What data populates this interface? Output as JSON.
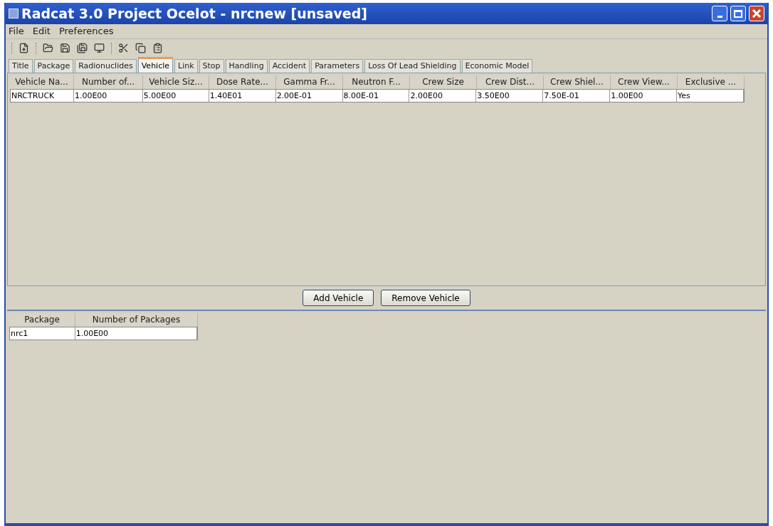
{
  "window": {
    "title": "Radcat 3.0 Project Ocelot - nrcnew [unsaved]"
  },
  "menu": [
    "File",
    "Edit",
    "Preferences"
  ],
  "tabs": [
    {
      "label": "Title",
      "selected": false
    },
    {
      "label": "Package",
      "selected": false
    },
    {
      "label": "Radionuclides",
      "selected": false
    },
    {
      "label": "Vehicle",
      "selected": true
    },
    {
      "label": "Link",
      "selected": false
    },
    {
      "label": "Stop",
      "selected": false
    },
    {
      "label": "Handling",
      "selected": false
    },
    {
      "label": "Accident",
      "selected": false
    },
    {
      "label": "Parameters",
      "selected": false
    },
    {
      "label": "Loss Of Lead Shielding",
      "selected": false
    },
    {
      "label": "Economic Model",
      "selected": false
    }
  ],
  "vehicle_table": {
    "columns": [
      "Vehicle Na...",
      "Number of...",
      "Vehicle Siz...",
      "Dose Rate...",
      "Gamma Fr...",
      "Neutron F...",
      "Crew Size",
      "Crew Dist...",
      "Crew Shiel...",
      "Crew View...",
      "Exclusive ..."
    ],
    "rows": [
      [
        "NRCTRUCK",
        "1.00E00",
        "5.00E00",
        "1.40E01",
        "2.00E-01",
        "8.00E-01",
        "2.00E00",
        "3.50E00",
        "7.50E-01",
        "1.00E00",
        "Yes"
      ]
    ]
  },
  "buttons": [
    "Add Vehicle",
    "Remove Vehicle"
  ],
  "package_table": {
    "columns": [
      "Package",
      "Number of Packages"
    ],
    "rows": [
      [
        "nrc1",
        "1.00E00"
      ]
    ]
  }
}
